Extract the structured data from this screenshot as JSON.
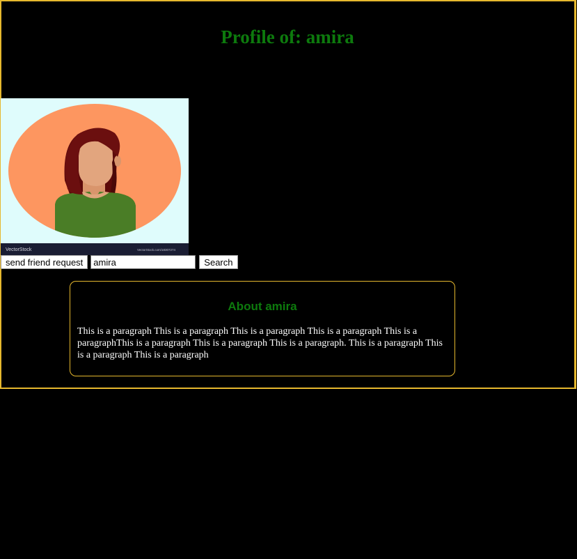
{
  "header": {
    "title": "Profile of: amira"
  },
  "avatar": {
    "icon": "female-avatar-illustration",
    "watermark_left": "VectorStock",
    "watermark_right": "VectorStock.com/18307274"
  },
  "controls": {
    "friend_request_label": "send friend request",
    "search_value": "amira",
    "search_button_label": "Search"
  },
  "about": {
    "title": "About amira",
    "text": "This is a paragraph This is a paragraph This is a paragraph This is a paragraph This is a paragraphThis is a paragraph This is a paragraph This is a paragraph. This is a paragraph This is a paragraph This is a paragraph"
  },
  "colors": {
    "background": "#000000",
    "border": "#e6b82e",
    "heading": "#0d7a0d",
    "text": "#ffffff"
  }
}
